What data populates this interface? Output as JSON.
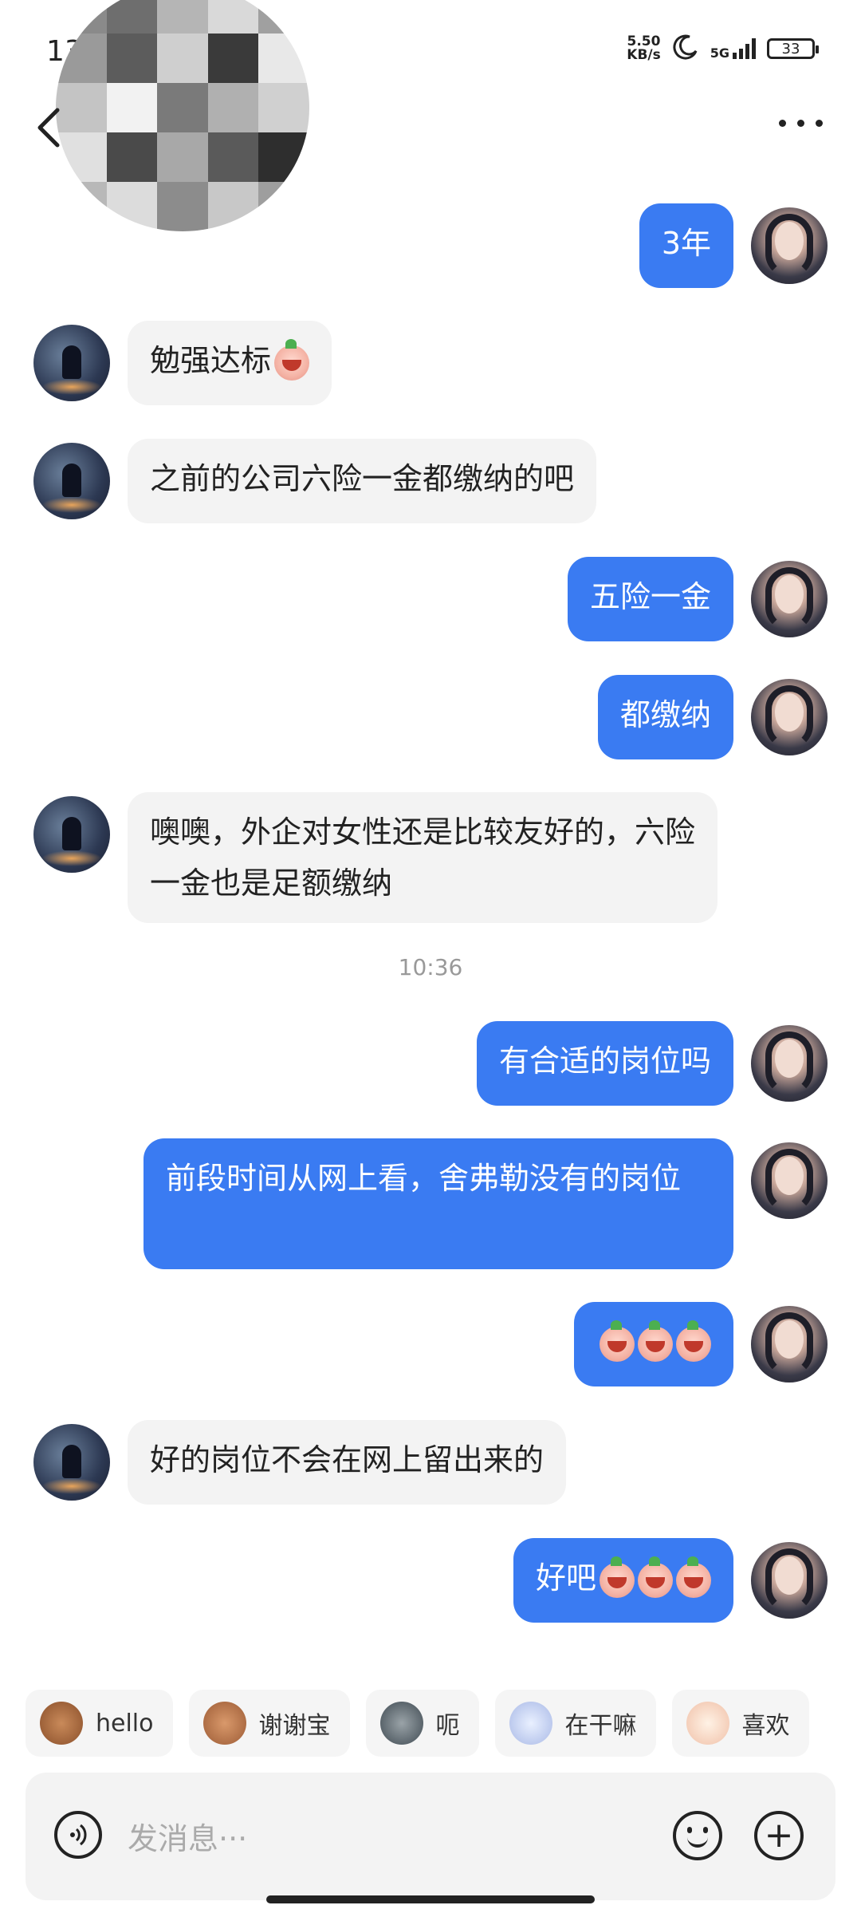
{
  "status_bar": {
    "time": "13",
    "net_speed_value": "5.50",
    "net_speed_unit": "KB/s",
    "signal_label": "5G",
    "battery": "33"
  },
  "header": {
    "back_icon": "chevron-left-icon",
    "more_icon": "more-dots-icon"
  },
  "messages": [
    {
      "side": "right",
      "text": "3年"
    },
    {
      "side": "left",
      "text": "勉强达标",
      "emoji": "crying-face"
    },
    {
      "side": "left",
      "text": "之前的公司六险一金都缴纳的吧"
    },
    {
      "side": "right",
      "text": "五险一金"
    },
    {
      "side": "right",
      "text": "都缴纳"
    },
    {
      "side": "left",
      "text": "噢噢，外企对女性还是比较友好的，六险一金也是足额缴纳"
    },
    {
      "side": "right",
      "text": "有合适的岗位吗"
    },
    {
      "side": "right",
      "text": "前段时间从网上看，舍弗勒没有的岗位"
    },
    {
      "side": "right",
      "text": "",
      "emoji": "crying-face x3"
    },
    {
      "side": "left",
      "text": "好的岗位不会在网上留出来的"
    },
    {
      "side": "right",
      "text": "好吧",
      "emoji": "crying-face x3"
    }
  ],
  "timestamp": "10:36",
  "quick_replies": [
    "hello",
    "谢谢宝",
    "呃",
    "在干嘛",
    "喜欢"
  ],
  "input": {
    "placeholder": "发消息···"
  },
  "colors": {
    "accent": "#3a7bf2",
    "bubble_left": "#f3f3f3"
  }
}
